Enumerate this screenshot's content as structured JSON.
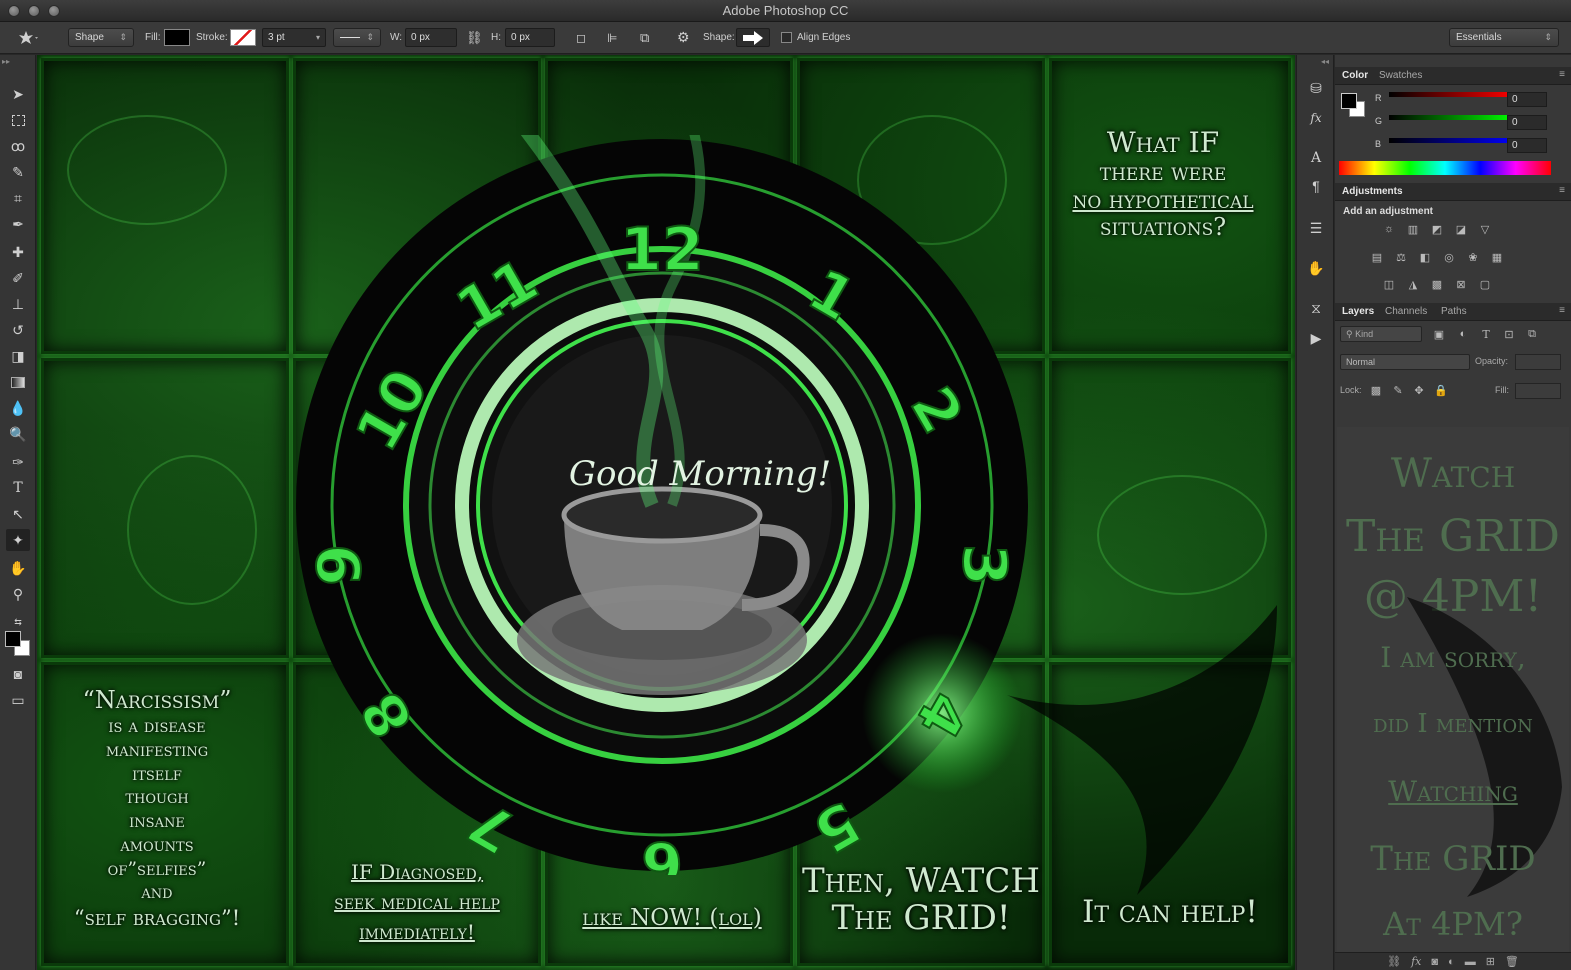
{
  "window": {
    "title": "Adobe Photoshop CC"
  },
  "options_bar": {
    "mode": "Shape",
    "fill_label": "Fill:",
    "stroke_label": "Stroke:",
    "stroke_width": "3 pt",
    "w_label": "W:",
    "w_value": "0 px",
    "h_label": "H:",
    "h_value": "0 px",
    "shape_label": "Shape:",
    "align_edges": "Align Edges",
    "workspace": "Essentials"
  },
  "canvas": {
    "clock_numbers": [
      "12",
      "1",
      "2",
      "3",
      "4",
      "5",
      "6",
      "7",
      "8",
      "9",
      "10",
      "11"
    ],
    "greeting": "Good Morning!",
    "text_top_right": [
      "What IF",
      "there were",
      "no hypothetical",
      "situations?"
    ],
    "text_bottom_left": [
      "“Narcissism”",
      "is a disease",
      "manifesting",
      "itself",
      "though",
      "insane",
      "amounts",
      "of”selfies”",
      "and",
      "“self bragging”!"
    ],
    "text_diagnosed": [
      "IF Diagnosed,",
      "seek medical help",
      "immediately!"
    ],
    "text_now": "like NOW! (lol)",
    "text_watch": [
      "Then, WATCH",
      "The GRID!"
    ],
    "text_help": "It can help!"
  },
  "panels": {
    "color_tabs": [
      "Color",
      "Swatches"
    ],
    "rgb": [
      {
        "label": "R",
        "value": "0"
      },
      {
        "label": "G",
        "value": "0"
      },
      {
        "label": "B",
        "value": "0"
      }
    ],
    "adjustments_tab": "Adjustments",
    "add_adjustment": "Add an adjustment",
    "layers_tabs": [
      "Layers",
      "Channels",
      "Paths"
    ],
    "kind_filter": "Kind",
    "blend_mode": "Normal",
    "opacity_label": "Opacity:",
    "lock_label": "Lock:",
    "fill_label": "Fill:",
    "layer_preview_lines": [
      "Watch",
      "The GRID",
      "@ 4PM!",
      "I am sorry,",
      "did I mention",
      "Watching",
      "The GRID",
      "At 4PM?"
    ]
  },
  "colors": {
    "accent_green": "#3fe04a",
    "panel_bg": "#383838",
    "canvas_dark": "#082a08"
  }
}
